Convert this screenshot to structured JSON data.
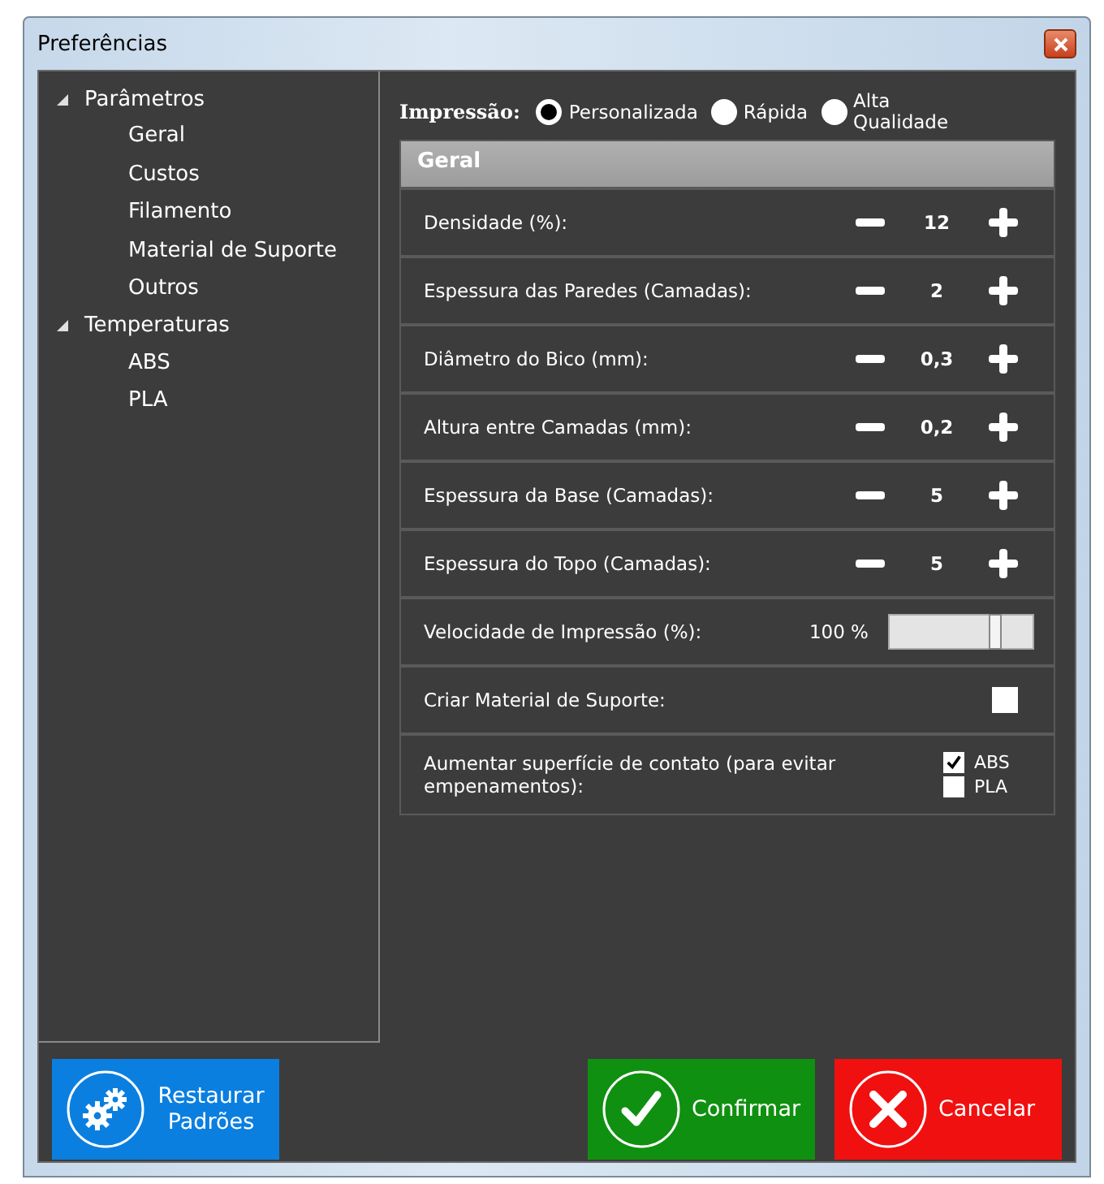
{
  "window": {
    "title": "Preferências"
  },
  "sidebar": {
    "items": [
      {
        "label": "Parâmetros",
        "expanded": true,
        "selected": false,
        "children": [
          {
            "label": "Geral",
            "selected": false
          },
          {
            "label": "Custos",
            "selected": false
          },
          {
            "label": "Filamento",
            "selected": false
          },
          {
            "label": "Material de Suporte",
            "selected": false
          },
          {
            "label": "Outros",
            "selected": false
          }
        ]
      },
      {
        "label": "Temperaturas",
        "expanded": true,
        "selected": false,
        "children": [
          {
            "label": "ABS",
            "selected": false
          },
          {
            "label": "PLA",
            "selected": false
          }
        ]
      }
    ]
  },
  "print_mode": {
    "label": "Impressão:",
    "options": [
      {
        "label": "Personalizada",
        "selected": true
      },
      {
        "label": "Rápida",
        "selected": false
      },
      {
        "label": "Alta Qualidade",
        "selected": false
      }
    ]
  },
  "group": {
    "title": "Geral",
    "rows": [
      {
        "kind": "stepper",
        "label": "Densidade (%):",
        "value": "12"
      },
      {
        "kind": "stepper",
        "label": "Espessura das Paredes (Camadas):",
        "value": "2"
      },
      {
        "kind": "stepper",
        "label": "Diâmetro do Bico (mm):",
        "value": "0,3"
      },
      {
        "kind": "stepper",
        "label": "Altura entre Camadas (mm):",
        "value": "0,2"
      },
      {
        "kind": "stepper",
        "label": "Espessura da Base (Camadas):",
        "value": "5"
      },
      {
        "kind": "stepper",
        "label": "Espessura do Topo (Camadas):",
        "value": "5"
      },
      {
        "kind": "slider",
        "label": "Velocidade de Impressão (%):",
        "reading": "100 %",
        "level": 0.74
      },
      {
        "kind": "checkbox",
        "label": "Criar Material de Suporte:",
        "checked": false
      },
      {
        "kind": "multi",
        "label": "Aumentar superfície de contato (para evitar empenamentos):",
        "options": [
          {
            "label": "ABS",
            "checked": true
          },
          {
            "label": "PLA",
            "checked": false
          }
        ]
      }
    ]
  },
  "buttons": [
    {
      "kind": "restore",
      "label": "Restaurar Padrões"
    },
    {
      "kind": "confirm",
      "label": "Confirmar"
    },
    {
      "kind": "cancel",
      "label": "Cancelar"
    }
  ]
}
